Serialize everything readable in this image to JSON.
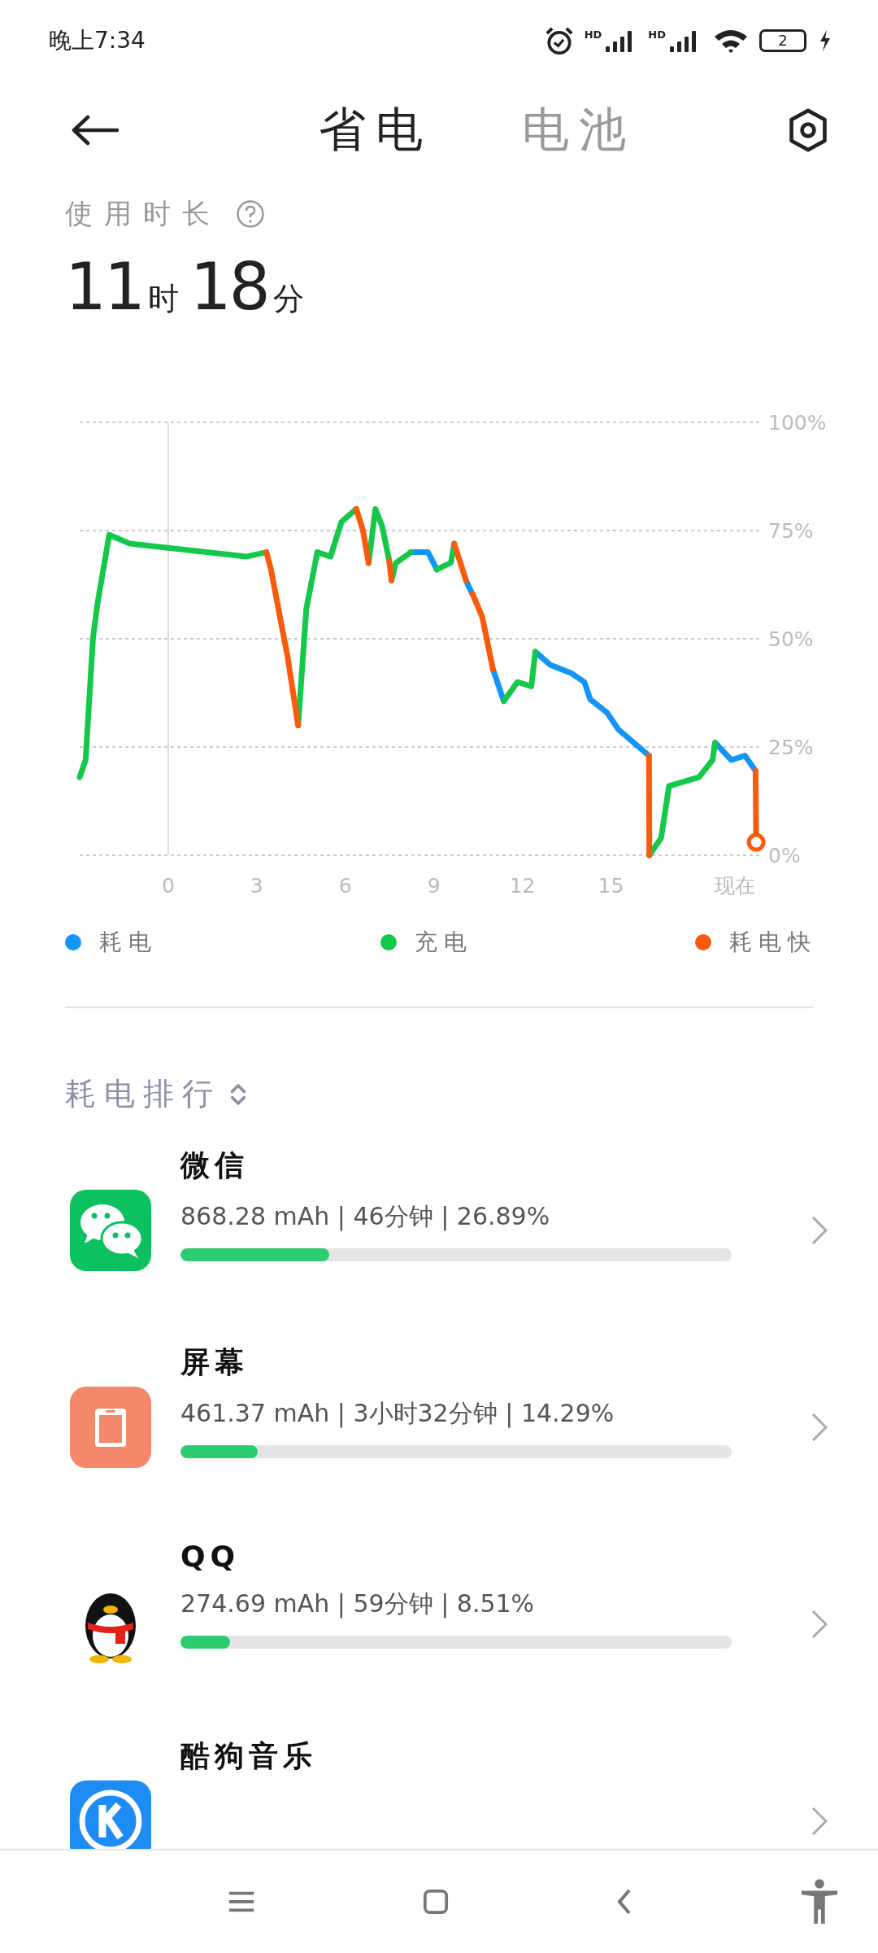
{
  "status_bar": {
    "time": "晚上7:34",
    "signals": [
      {
        "label": "HD"
      },
      {
        "label": "HD"
      }
    ],
    "battery": "2",
    "charging": true
  },
  "header": {
    "tabs": [
      {
        "label": "省电",
        "selected": true
      },
      {
        "label": "电池",
        "selected": false
      }
    ]
  },
  "usage": {
    "label": "使用时长",
    "hours": "11",
    "hours_unit": "时",
    "minutes": "18",
    "minutes_unit": "分"
  },
  "usage_chart": {
    "chart_data": {
      "type": "line",
      "grid": true,
      "x": [
        -3.0,
        -2.8,
        -2.55,
        -2.4,
        -2.0,
        -1.3,
        2.66,
        3.33,
        3.48,
        4.04,
        4.4,
        4.68,
        5.05,
        5.5,
        5.87,
        6.37,
        6.6,
        6.79,
        7.02,
        7.25,
        7.49,
        7.56,
        7.57,
        7.71,
        8.22,
        8.8,
        9.1,
        9.58,
        9.69,
        10.09,
        10.3,
        10.31,
        10.64,
        11.0,
        11.37,
        11.83,
        12.3,
        12.44,
        12.94,
        13.67,
        14.1,
        14.3,
        14.86,
        15.26,
        16.29,
        16.3,
        16.7,
        16.97,
        17.98,
        18.44,
        18.53,
        19.08,
        19.54,
        19.9,
        19.92
      ],
      "series": [
        {
          "name": "耗电",
          "color": "#1296f5",
          "values": [
            null,
            null,
            null,
            null,
            null,
            null,
            null,
            null,
            null,
            null,
            null,
            null,
            null,
            null,
            null,
            null,
            null,
            null,
            null,
            null,
            null,
            null,
            null,
            null,
            70,
            70,
            66,
            null,
            null,
            63.5,
            60.4,
            null,
            null,
            43,
            35.6,
            null,
            null,
            47,
            44,
            42,
            40,
            36,
            33,
            29,
            23,
            null,
            null,
            null,
            null,
            null,
            26,
            22,
            23,
            19.5,
            null
          ]
        },
        {
          "name": "充电",
          "color": "#14c94a",
          "values": [
            18,
            22,
            50,
            58,
            74,
            72,
            69,
            70,
            null,
            null,
            30,
            57,
            70,
            69,
            77,
            80,
            null,
            67.5,
            80,
            76,
            68,
            null,
            63.5,
            67.5,
            70,
            null,
            66,
            67.6,
            72,
            null,
            null,
            null,
            null,
            null,
            35.6,
            40,
            39,
            47,
            null,
            null,
            null,
            null,
            null,
            null,
            null,
            0,
            4,
            16,
            18,
            22,
            26,
            null,
            null,
            null,
            null
          ]
        },
        {
          "name": "耗电快",
          "color": "#fa5a0a",
          "values": [
            null,
            null,
            null,
            null,
            null,
            null,
            null,
            70,
            66,
            46,
            30,
            null,
            null,
            null,
            null,
            80,
            75,
            67.5,
            null,
            null,
            68,
            63.5,
            null,
            null,
            null,
            null,
            null,
            null,
            72,
            63.5,
            null,
            60.4,
            55,
            43,
            null,
            null,
            null,
            null,
            null,
            null,
            null,
            null,
            null,
            null,
            23,
            0,
            null,
            null,
            null,
            null,
            null,
            null,
            null,
            19.5,
            3
          ]
        }
      ],
      "xlim": [
        -3,
        20
      ],
      "ylim": [
        0,
        100
      ],
      "xticks": [
        0,
        3,
        6,
        9,
        12,
        15,
        {
          "value": 19.2,
          "label": "现在"
        }
      ],
      "yticks": [
        {
          "value": 0,
          "label": "0%"
        },
        {
          "value": 25,
          "label": "25%"
        },
        {
          "value": 50,
          "label": "50%"
        },
        {
          "value": 75,
          "label": "75%"
        },
        {
          "value": 100,
          "label": "100%"
        }
      ]
    }
  },
  "ranking": {
    "title": "耗电排行",
    "apps": [
      {
        "kind": "wechat",
        "name": "微信",
        "stats": "868.28 mAh | 46分钟 | 26.89%",
        "level": 0.27
      },
      {
        "kind": "screen",
        "name": "屏幕",
        "stats": "461.37 mAh | 3小时32分钟 | 14.29%",
        "level": 0.14
      },
      {
        "kind": "penguin",
        "name": "QQ",
        "stats": "274.69 mAh | 59分钟 | 8.51%",
        "level": 0.09
      },
      {
        "kind": "music",
        "name": "酷狗音乐"
      }
    ]
  }
}
